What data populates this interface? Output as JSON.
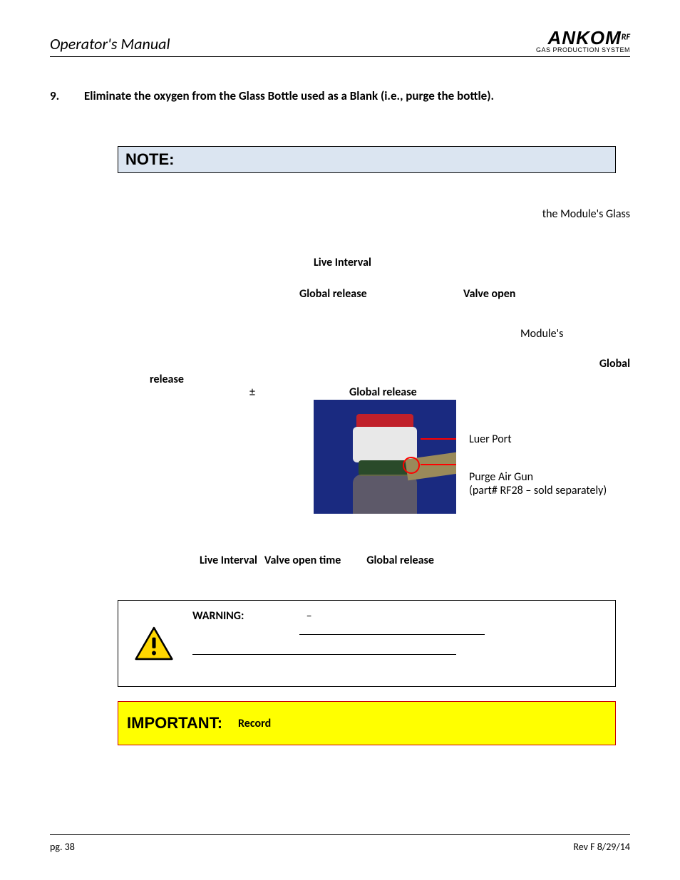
{
  "header": {
    "title": "Operator's Manual",
    "logo_main": "ANKOM",
    "logo_rf": "RF",
    "logo_sub": "GAS PRODUCTION SYSTEM"
  },
  "step": {
    "number": "9.",
    "text": "Eliminate the oxygen from the Glass Bottle used as a Blank (i.e., purge the bottle)."
  },
  "note": {
    "label": "NOTE:"
  },
  "mid": {
    "module_glass": "the Module's Glass",
    "live_interval": "Live  Interval",
    "global_release_1": "Global release",
    "valve_open": "Valve open",
    "modules": "Module's",
    "global": "Global",
    "release": "release",
    "pm": "±",
    "global_release_2": "Global release"
  },
  "image_labels": {
    "luer": "Luer Port",
    "gun_l1": "Purge Air Gun",
    "gun_l2": "(part# RF28 – sold separately)"
  },
  "after_img": {
    "live_interval": "Live Interval",
    "valve_open_time": "Valve open time",
    "global_release": "Global release"
  },
  "warning": {
    "label": "WARNING:",
    "dash": "–"
  },
  "important": {
    "label": "IMPORTANT:",
    "record": "Record"
  },
  "footer": {
    "page": "pg. 38",
    "rev": "Rev F 8/29/14"
  }
}
